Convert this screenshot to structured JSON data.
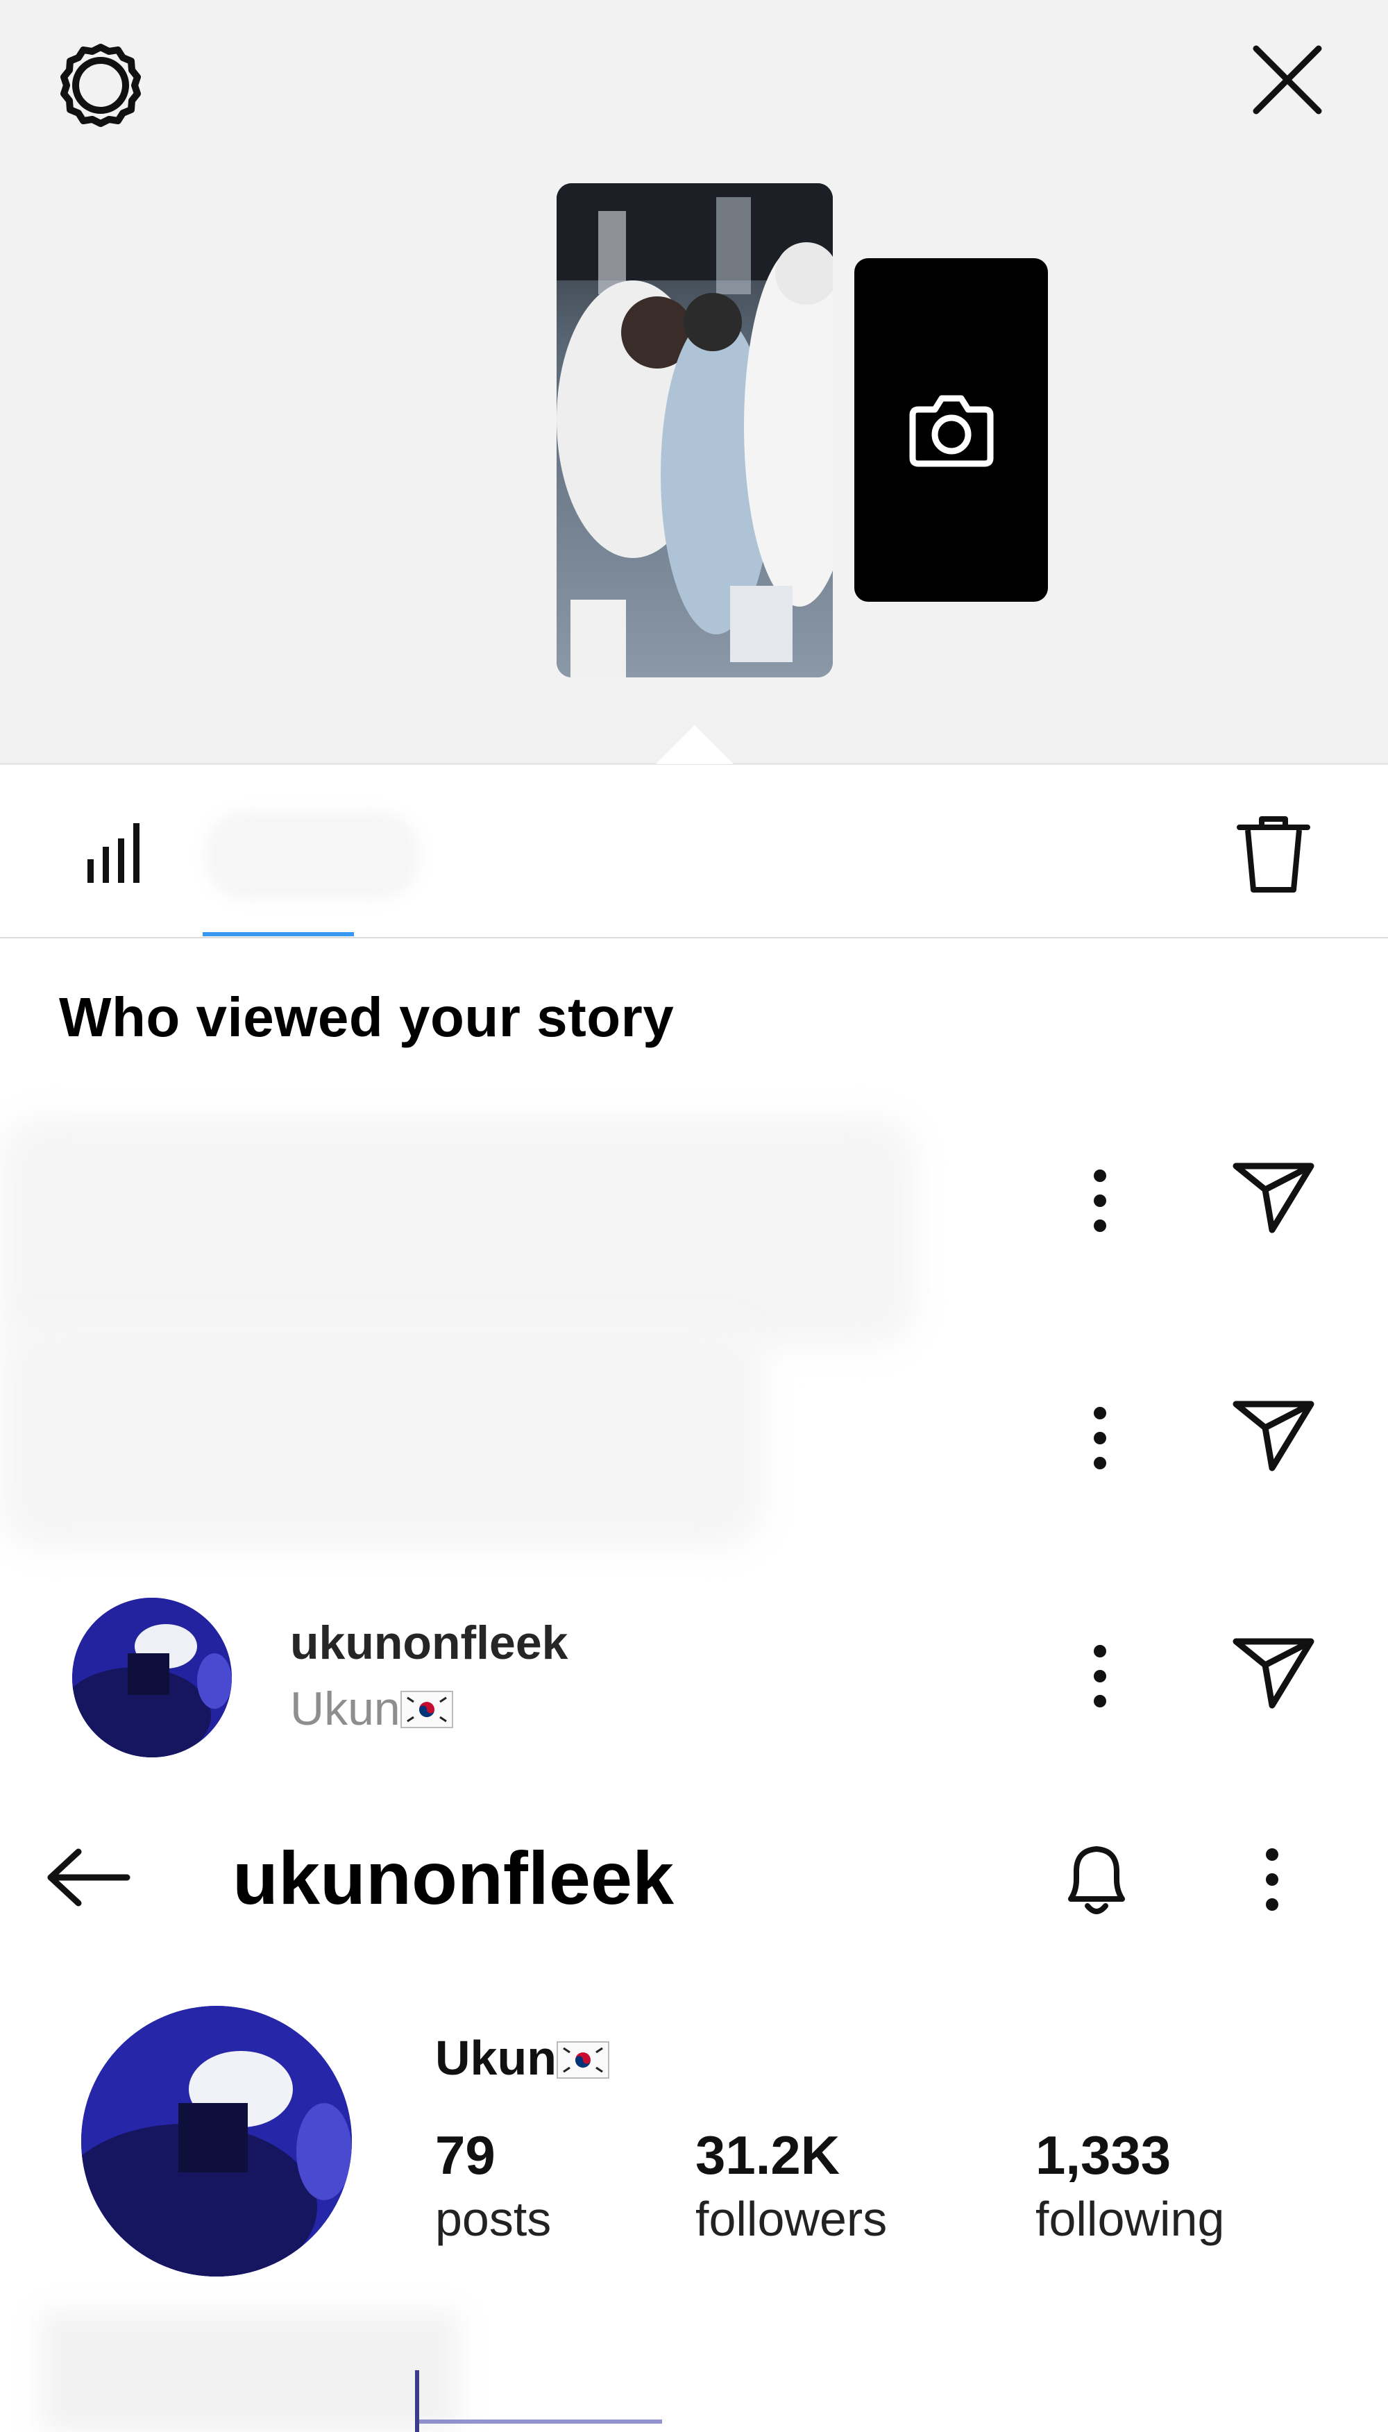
{
  "story_viewer": {
    "settings_icon": "gear-icon",
    "close_icon": "close-icon",
    "camera_icon": "camera-icon",
    "tabs": {
      "insights_icon": "bar-chart-icon",
      "delete_icon": "trash-icon"
    },
    "section_title": "Who viewed your story",
    "viewers": [
      {
        "username": "",
        "full_name": ""
      },
      {
        "username": "",
        "full_name": ""
      },
      {
        "username": "ukunonfleek",
        "full_name": "Ukun",
        "flag": "south-korea-flag"
      }
    ],
    "row_actions": {
      "more_icon": "more-vertical-icon",
      "send_icon": "send-icon"
    }
  },
  "profile": {
    "header_title": "ukunonfleek",
    "back_icon": "arrow-left-icon",
    "bell_icon": "bell-icon",
    "menu_icon": "more-vertical-icon",
    "display_name": "Ukun",
    "stats": [
      {
        "value": "79",
        "label": "posts"
      },
      {
        "value": "31.2K",
        "label": "followers"
      },
      {
        "value": "1,333",
        "label": "following"
      }
    ]
  },
  "colors": {
    "accent": "#3897f0",
    "tray_bg": "#f2f2f2",
    "muted_text": "#8e8e8e"
  }
}
